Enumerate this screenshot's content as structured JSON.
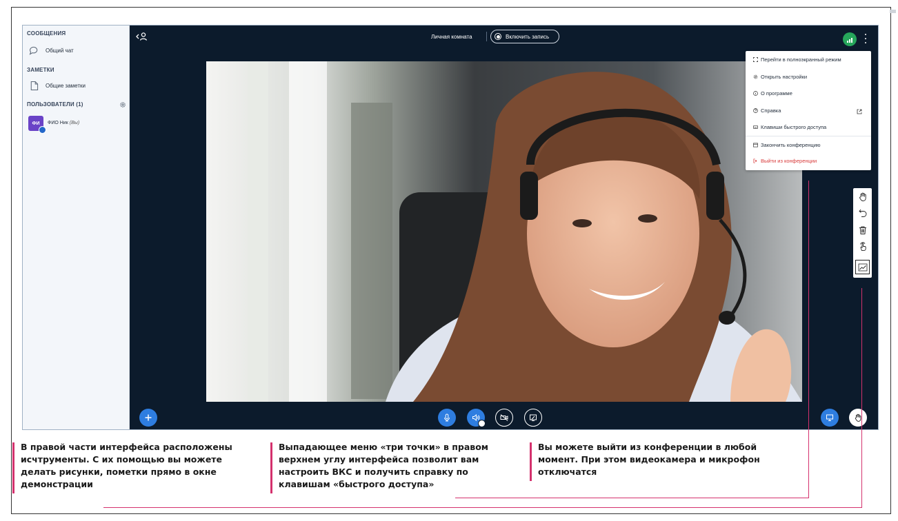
{
  "sidebar": {
    "messages_heading": "СООБЩЕНИЯ",
    "public_chat": "Общий чат",
    "notes_heading": "ЗАМЕТКИ",
    "shared_notes": "Общие заметки",
    "users_heading": "ПОЛЬЗОВАТЕЛИ (1)",
    "user": {
      "avatar_initials": "ФИ",
      "name": "ФИО Ник",
      "you_label": "(Вы)"
    }
  },
  "header": {
    "room_title": "Личная комната",
    "record_label": "Включить запись"
  },
  "menu": {
    "items": [
      {
        "label": "Перейти в полноэкранный режим",
        "icon": "fullscreen-icon"
      },
      {
        "label": "Открыть настройки",
        "icon": "gear-icon"
      },
      {
        "label": "О программе",
        "icon": "info-icon"
      },
      {
        "label": "Справка",
        "icon": "help-icon"
      },
      {
        "label": "Клавиши быстрого доступа",
        "icon": "keyboard-icon"
      },
      {
        "label": "Закончить конференцию",
        "icon": "window-icon"
      },
      {
        "label": "Выйти из конференции",
        "icon": "logout-icon"
      }
    ]
  },
  "tools": [
    "hand-icon",
    "undo-icon",
    "trash-icon",
    "pointer-icon",
    "chart-icon"
  ],
  "captions": {
    "left": [
      "В правой части интерфейса расположены",
      "исчтрументы. С их помощью вы можете",
      "делать рисунки, пометки прямо в окне",
      "демонстрации"
    ],
    "middle": [
      "Выпадающее меню «три точки» в правом",
      "верхнем углу интерфейса позволит вам",
      "настроить ВКС и получить справку по",
      "клавишам «быстрого доступа»"
    ],
    "right": [
      "Вы можете выйти из конференции в любой",
      "момент. При этом видеокамера и микрофон",
      "отключатся"
    ]
  },
  "colors": {
    "app_bg": "#0c1b2c",
    "accent_blue": "#2e7de0",
    "caption_accent": "#d4316d",
    "danger": "#d83a3a",
    "signal_green": "#26a65b"
  }
}
